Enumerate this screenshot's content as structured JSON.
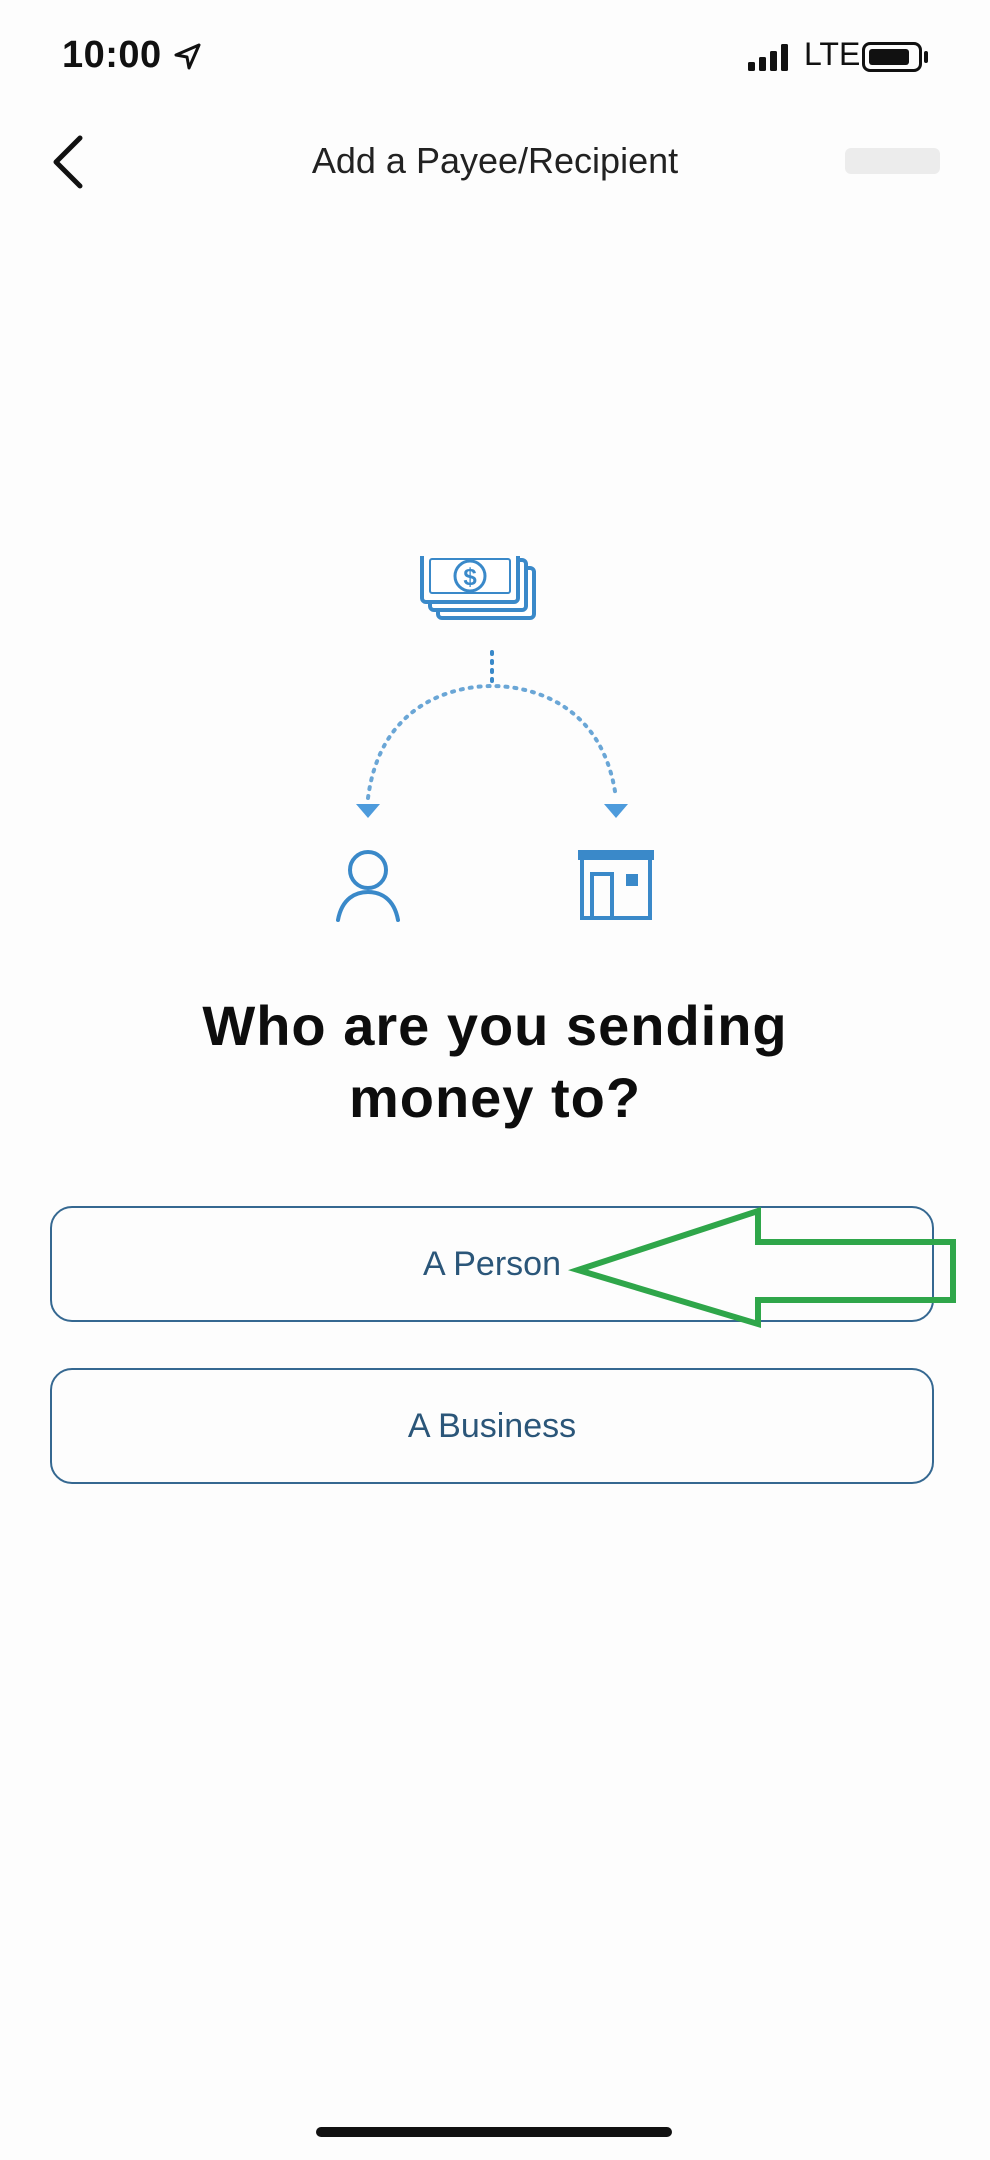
{
  "status_bar": {
    "time": "10:00",
    "network": "LTE"
  },
  "header": {
    "title": "Add a Payee/Recipient"
  },
  "prompt": {
    "line1": "Who are you sending",
    "line2": "money to?"
  },
  "options": [
    {
      "label": "A Person"
    },
    {
      "label": "A Business"
    }
  ],
  "illustration": {
    "icons": [
      "money-stack-icon",
      "person-icon",
      "storefront-icon"
    ]
  },
  "colors": {
    "accent": "#2b5679",
    "illustration_blue": "#3a89c9",
    "arrow_green": "#2fa64a"
  }
}
